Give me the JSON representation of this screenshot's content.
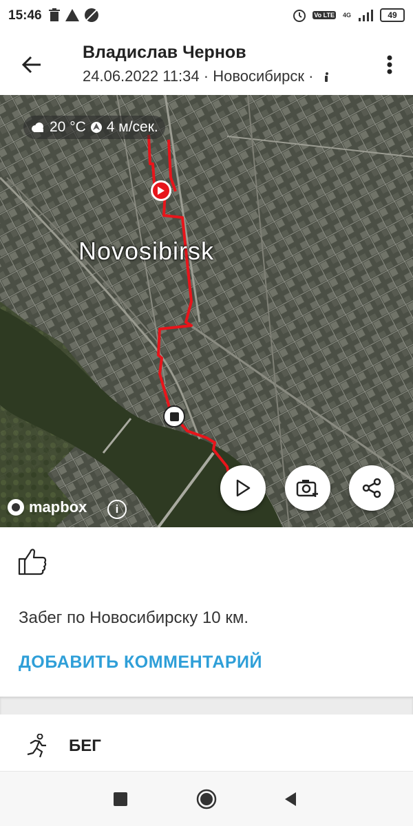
{
  "status_bar": {
    "time": "15:46",
    "battery": "49",
    "network_badge_1": "Vo LTE",
    "network_badge_2": "4G"
  },
  "header": {
    "title": "Владислав Чернов",
    "subtitle": "24.06.2022 11:34 · Новосибирск ·"
  },
  "map": {
    "weather": "20 °C",
    "wind": "4 м/сек.",
    "city_label": "Novosibirsk",
    "attribution": "mapbox",
    "info_symbol": "i",
    "route_color": "#e8151b"
  },
  "content": {
    "description": "Забег по Новосибирску 10 км.",
    "add_comment": "ДОБАВИТЬ КОММЕНТАРИЙ"
  },
  "activity": {
    "type_label": "БЕГ"
  },
  "colors": {
    "accent": "#2f9fd8",
    "route": "#e8151b"
  }
}
